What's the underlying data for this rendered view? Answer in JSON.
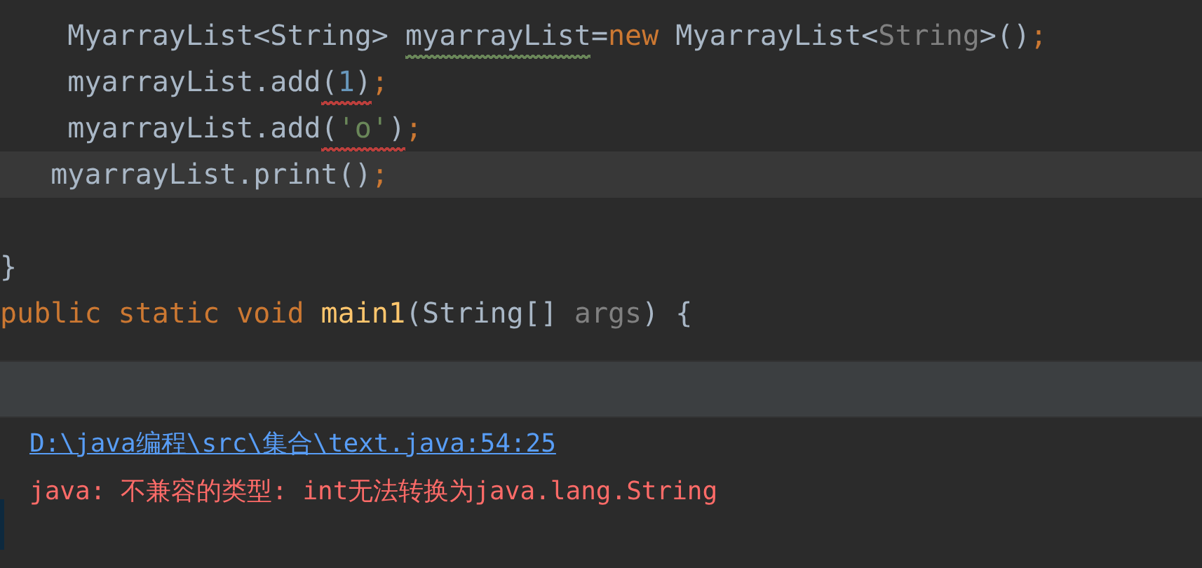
{
  "editor": {
    "lines": [
      {
        "tokens": [
          {
            "text": "    MyarrayList<String> ",
            "kind": "plain"
          },
          {
            "warning": true,
            "tokens": [
              {
                "text": "myarrayList",
                "kind": "plain"
              }
            ]
          },
          {
            "text": "=",
            "kind": "plain"
          },
          {
            "text": "new ",
            "kind": "keyword"
          },
          {
            "text": "MyarrayList<",
            "kind": "plain"
          },
          {
            "text": "String",
            "kind": "dim"
          },
          {
            "text": ">()",
            "kind": "plain"
          },
          {
            "text": ";",
            "kind": "keyword"
          }
        ],
        "current": false
      },
      {
        "tokens": [
          {
            "text": "    myarrayList.add",
            "kind": "plain"
          },
          {
            "error": true,
            "tokens": [
              {
                "text": "(",
                "kind": "plain"
              },
              {
                "text": "1",
                "kind": "number"
              },
              {
                "text": ")",
                "kind": "plain"
              }
            ]
          },
          {
            "text": ";",
            "kind": "keyword"
          }
        ],
        "current": false
      },
      {
        "tokens": [
          {
            "text": "    myarrayList.add",
            "kind": "plain"
          },
          {
            "error": true,
            "tokens": [
              {
                "text": "(",
                "kind": "plain"
              },
              {
                "text": "'o'",
                "kind": "string"
              },
              {
                "text": ")",
                "kind": "plain"
              }
            ]
          },
          {
            "text": ";",
            "kind": "keyword"
          }
        ],
        "current": false
      },
      {
        "tokens": [
          {
            "text": "   myarrayList.print()",
            "kind": "plain"
          },
          {
            "text": ";",
            "kind": "keyword"
          }
        ],
        "current": true
      },
      {
        "current": false
      },
      {
        "tokens": [
          {
            "text": "}",
            "kind": "plain"
          }
        ],
        "current": false
      },
      {
        "tokens": [
          {
            "text": "public static void ",
            "kind": "keyword"
          },
          {
            "text": "main1",
            "kind": "method"
          },
          {
            "text": "(String[] ",
            "kind": "plain"
          },
          {
            "text": "args",
            "kind": "dim"
          },
          {
            "text": ") {",
            "kind": "plain"
          }
        ],
        "current": false
      }
    ]
  },
  "problems": {
    "location": "D:\\java编程\\src\\集合\\text.java:54:25",
    "message": "java: 不兼容的类型: int无法转换为java.lang.String"
  }
}
